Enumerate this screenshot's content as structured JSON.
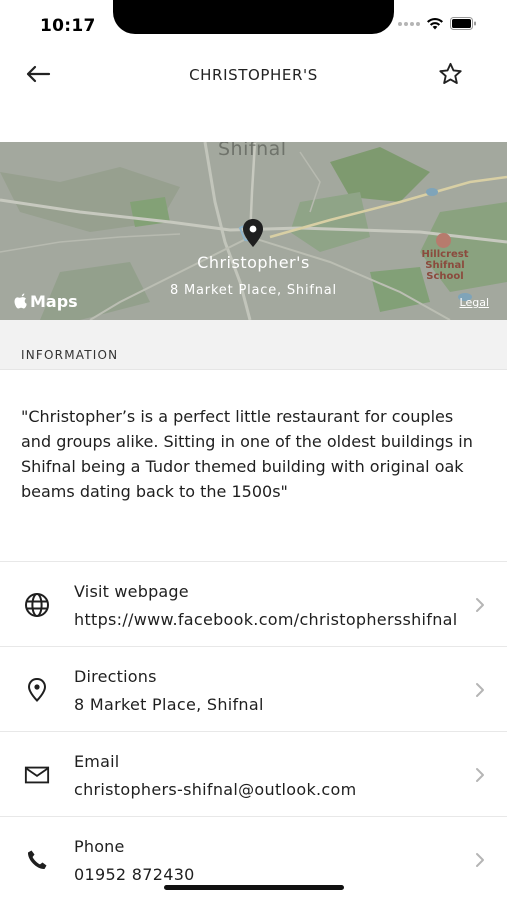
{
  "status_bar": {
    "time": "10:17"
  },
  "nav": {
    "title": "CHRISTOPHER'S",
    "back_icon": "arrow-left-icon",
    "favorite_icon": "star-outline-icon"
  },
  "map": {
    "town_label": "Shifnal",
    "place_name": "Christopher's",
    "address": "8 Market Place, Shifnal",
    "maps_brand": "Maps",
    "legal": "Legal",
    "poi_label": "Hillcrest Shifnal School"
  },
  "section": {
    "title": "INFORMATION"
  },
  "description": "\"Christopher’s is a perfect little restaurant for couples and groups alike. Sitting in one of the oldest buildings in Shifnal being a Tudor themed building with original oak beams dating back to the 1500s\"",
  "rows": [
    {
      "icon": "globe-icon",
      "label": "Visit webpage",
      "value": "https://www.facebook.com/christophersshifnal"
    },
    {
      "icon": "location-pin-icon",
      "label": "Directions",
      "value": "8 Market Place, Shifnal"
    },
    {
      "icon": "mail-icon",
      "label": "Email",
      "value": "christophers-shifnal@outlook.com"
    },
    {
      "icon": "phone-icon",
      "label": "Phone",
      "value": "01952 872430"
    }
  ]
}
